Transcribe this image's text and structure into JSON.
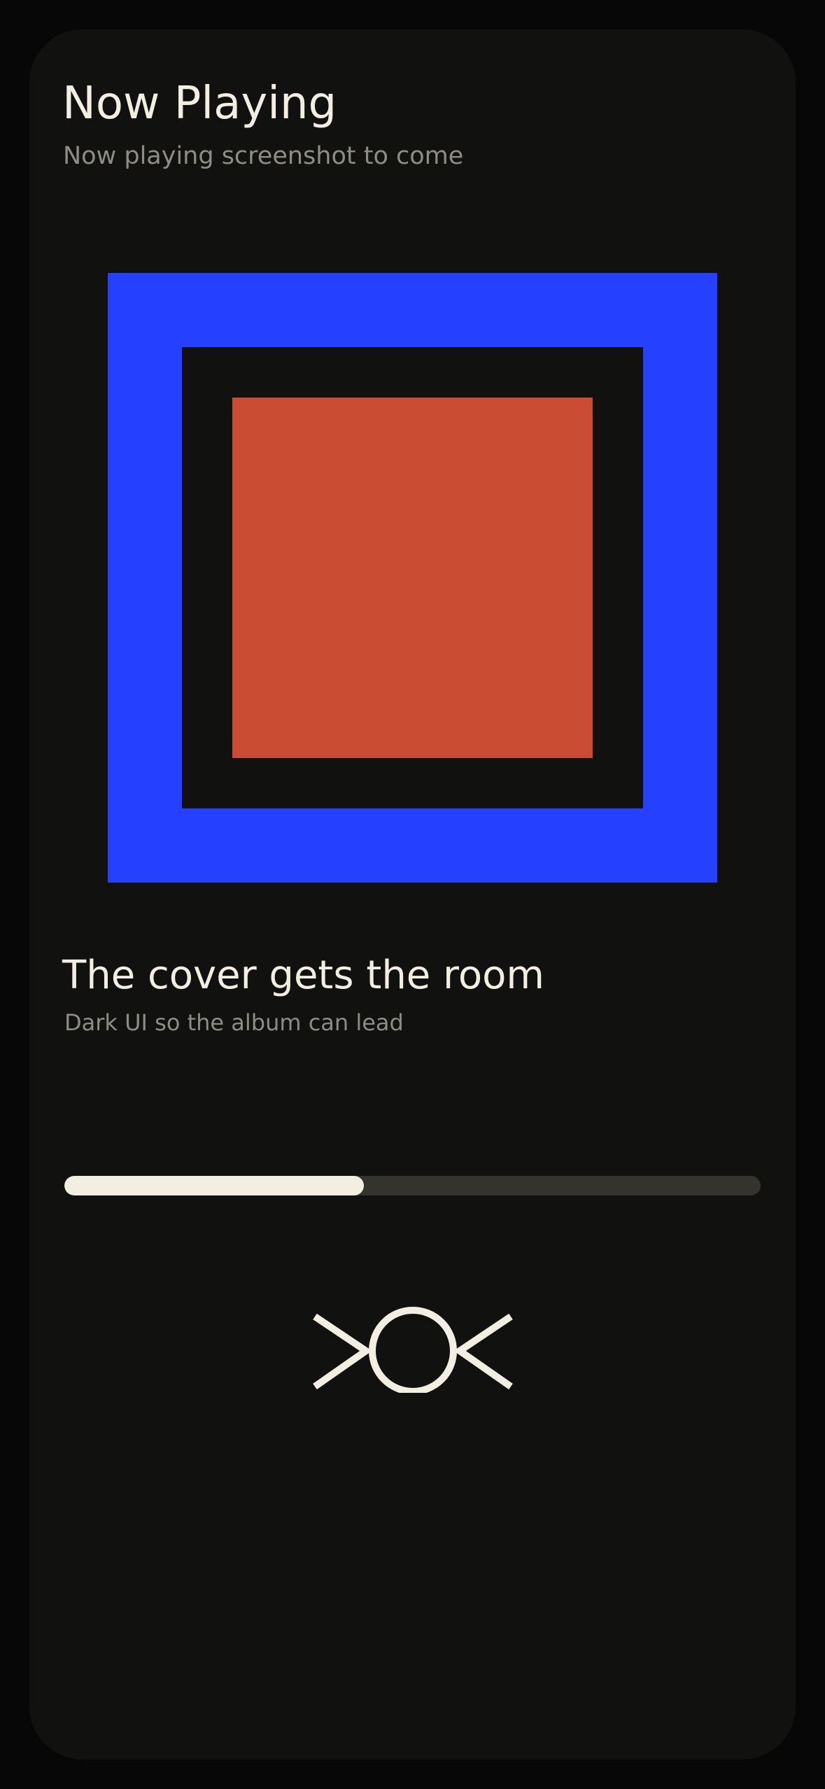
{
  "header": {
    "title": "Now Playing",
    "subtitle": "Now playing screenshot to come"
  },
  "album_art": {
    "outer_color": "#2541ff",
    "inner_color": "#111110",
    "core_color": "#ca4d33"
  },
  "track": {
    "title": "The cover gets the room",
    "subtitle": "Dark UI so the album can lead"
  },
  "playback": {
    "progress_percent": 43,
    "progress_fill_color": "#f2eee2",
    "progress_track_color": "#34332e"
  },
  "controls": {
    "icons": [
      "previous-icon",
      "play-icon",
      "next-icon"
    ],
    "icon_color": "#f2eee2"
  }
}
